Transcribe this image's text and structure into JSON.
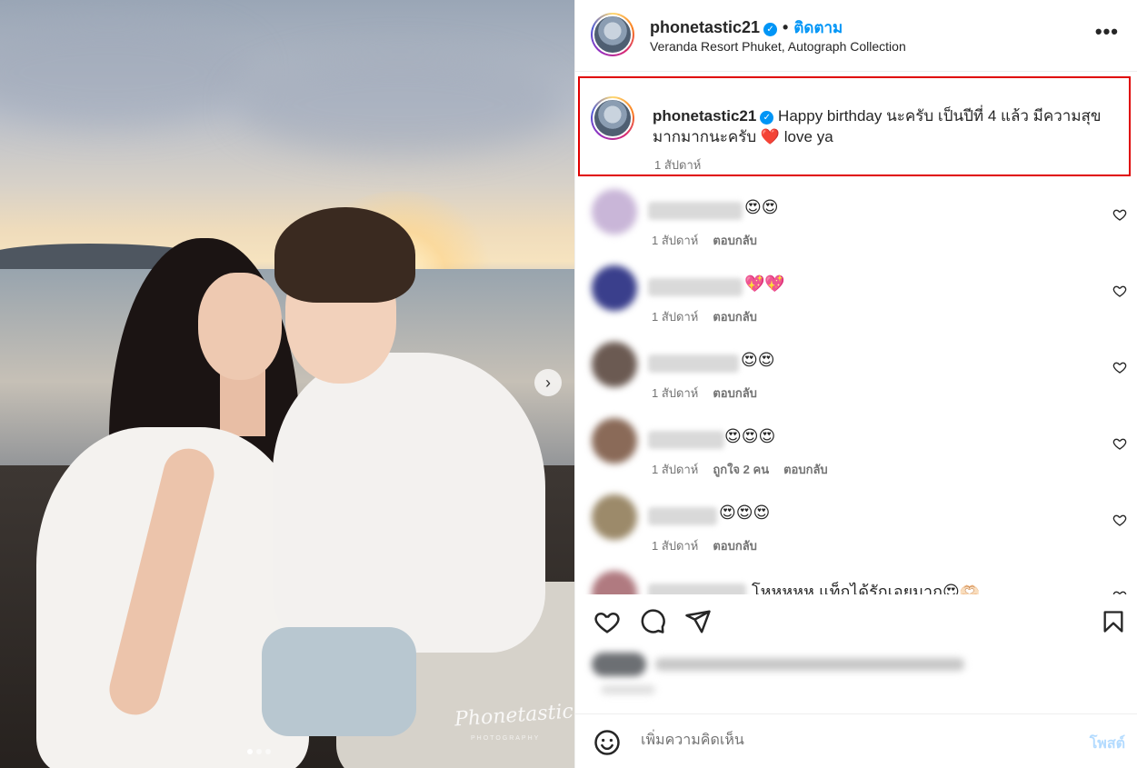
{
  "post": {
    "username": "phonetastic21",
    "follow_label": "ติดตาม",
    "separator": "•",
    "location": "Veranda Resort Phuket, Autograph Collection",
    "more_label": "•••",
    "watermark": "Phonetastic",
    "watermark_sub": "PHOTOGRAPHY",
    "carousel": {
      "count": 3,
      "active": 1
    }
  },
  "caption": {
    "username": "phonetastic21",
    "text_before_heart": "Happy birthday นะครับ เป็นปีที่ 4 แล้ว มีความสุขมากมากนะครับ",
    "heart": "❤️",
    "text_after_heart": "love ya",
    "time": "1 สัปดาห์"
  },
  "comments": [
    {
      "text": "😍😍",
      "time": "1 สัปดาห์",
      "likes": "",
      "reply": "ตอบกลับ"
    },
    {
      "text": "💖💖",
      "time": "1 สัปดาห์",
      "likes": "",
      "reply": "ตอบกลับ"
    },
    {
      "text": "😍😍",
      "time": "1 สัปดาห์",
      "likes": "",
      "reply": "ตอบกลับ"
    },
    {
      "text": "😍😍😍",
      "time": "1 สัปดาห์",
      "likes": "ถูกใจ 2 คน",
      "reply": "ตอบกลับ"
    },
    {
      "text": "😍😍😍",
      "time": "1 สัปดาห์",
      "likes": "",
      "reply": "ตอบกลับ"
    },
    {
      "text": "โหหหหห แท็กได้รักเอยมาก😍🫶🏻"
    }
  ],
  "composer": {
    "placeholder": "เพิ่มความคิดเห็น",
    "post_label": "โพสต์"
  },
  "colors": {
    "accent": "#0095f6",
    "highlight_border": "#e00000",
    "post_disabled": "#b3dbff",
    "meta_text": "#737373"
  },
  "icons": [
    "verified-badge-icon",
    "more-icon",
    "heart-icon",
    "comment-icon",
    "share-icon",
    "bookmark-icon",
    "emoji-icon",
    "chevron-right-icon"
  ]
}
